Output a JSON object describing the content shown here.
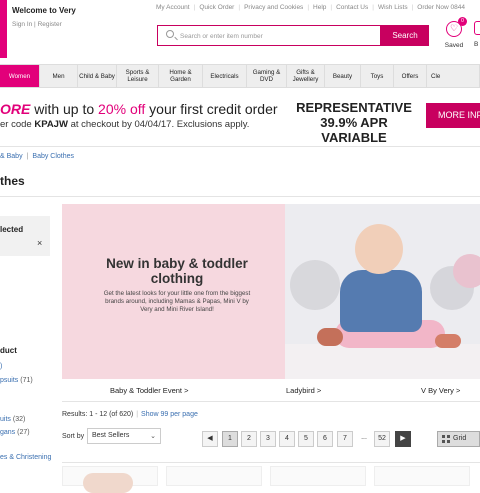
{
  "header": {
    "welcome": "Welcome to Very",
    "sign_in": "Sign In",
    "register": "Register",
    "util_links": [
      "My Account",
      "Quick Order",
      "Privacy and Cookies",
      "Help",
      "Contact Us",
      "Wish Lists",
      "Order Now 0844"
    ],
    "search_placeholder": "Search or enter item number",
    "search_button": "Search",
    "saved_label": "Saved",
    "saved_count": "0",
    "bag_label": "B"
  },
  "nav": [
    {
      "label": "Women",
      "active": true
    },
    {
      "label": "Men"
    },
    {
      "label": "Child & Baby"
    },
    {
      "label": "Sports & Leisure"
    },
    {
      "label": "Home & Garden"
    },
    {
      "label": "Electricals"
    },
    {
      "label": "Gaming & DVD"
    },
    {
      "label": "Gifts & Jewellery"
    },
    {
      "label": "Beauty"
    },
    {
      "label": "Toys"
    },
    {
      "label": "Offers"
    },
    {
      "label": "Cle"
    }
  ],
  "promo": {
    "line1_more": "ORE",
    "line1_mid": " with up to ",
    "line1_pct": "20% off",
    "line1_end": " your first credit order",
    "line2_pre": "er code ",
    "line2_code": "KPAJW",
    "line2_post": " at checkout by 04/04/17. Exclusions apply.",
    "rep_line1": "REPRESENTATIVE",
    "rep_line2": "39.9% APR VARIABLE",
    "more_info": "MORE INF"
  },
  "breadcrumb": [
    "& Baby",
    "Baby Clothes"
  ],
  "page_title": "thes",
  "filters": {
    "selected_title": "lected",
    "clear": "×",
    "product_heading": "duct",
    "links": [
      {
        "label": ")",
        "count": ""
      },
      {
        "label": "psuits",
        "count": "(71)"
      },
      {
        "label": "uits",
        "count": "(32)"
      },
      {
        "label": "gans",
        "count": "(27)"
      },
      {
        "label": "es & Christening",
        "count": ""
      }
    ]
  },
  "hero": {
    "headline": "New in baby & toddler clothing",
    "body": "Get the latest looks for your little one from the biggest brands around, including Mamas & Papas, Mini V by Very and Mini River Island!",
    "captions": [
      "Baby & Toddler Event >",
      "Ladybird >",
      "V By Very >"
    ]
  },
  "listing": {
    "results": "Results: 1 - 12 (of 620)",
    "show_link": "Show 99 per page",
    "sort_label": "Sort by",
    "sort_value": "Best Sellers",
    "pages": [
      "1",
      "2",
      "3",
      "4",
      "5",
      "6",
      "7",
      "...",
      "52"
    ],
    "current_page": "1",
    "grid_label": "Grid"
  }
}
